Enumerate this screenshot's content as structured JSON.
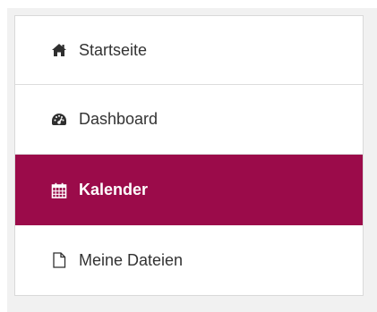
{
  "menu": {
    "items": [
      {
        "label": "Startseite",
        "icon": "home-icon",
        "active": false
      },
      {
        "label": "Dashboard",
        "icon": "dashboard-gauge-icon",
        "active": false
      },
      {
        "label": "Kalender",
        "icon": "calendar-icon",
        "active": true
      },
      {
        "label": "Meine Dateien",
        "icon": "file-icon",
        "active": false
      }
    ]
  },
  "colors": {
    "active_bg": "#9b0b4a",
    "active_text": "#ffffff",
    "text": "#333333",
    "border": "#d9d9d9",
    "frame_bg": "#f1f1f1"
  }
}
